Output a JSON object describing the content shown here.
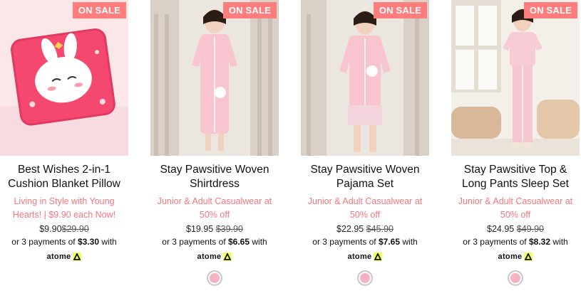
{
  "colors": {
    "sale_badge": "#ff7d7d",
    "promo_text": "#f2777f",
    "swatch_pink": "#f5b3c2",
    "atome_yellow": "#f0ff5a"
  },
  "products": [
    {
      "badge": "ON SALE",
      "title_line1": "Best Wishes 2-in-1",
      "title_line2": "Cushion Blanket Pillow",
      "promo_line1": "Living in Style with Young",
      "promo_line2": "Hearts! | $9.90 each Now!",
      "price": "$9.90",
      "old_price": "$29.90",
      "installment_prefix": "or 3 payments of",
      "installment_amount": "$3.30",
      "installment_suffix": "with",
      "pay_brand": "atome",
      "has_swatch": false
    },
    {
      "badge": "ON SALE",
      "title_line1": "Stay Pawsitive Woven",
      "title_line2": "Shirtdress",
      "promo_line1": "Junior & Adult Casualwear at",
      "promo_line2": "50% off",
      "price": "$19.95",
      "old_price": "$39.90",
      "installment_prefix": "or 3 payments of",
      "installment_amount": "$6.65",
      "installment_suffix": "with",
      "pay_brand": "atome",
      "has_swatch": true
    },
    {
      "badge": "ON SALE",
      "title_line1": "Stay Pawsitive Woven",
      "title_line2": "Pajama Set",
      "promo_line1": "Junior & Adult Casualwear at",
      "promo_line2": "50% off",
      "price": "$22.95",
      "old_price": "$45.90",
      "installment_prefix": "or 3 payments of",
      "installment_amount": "$7.65",
      "installment_suffix": "with",
      "pay_brand": "atome",
      "has_swatch": true
    },
    {
      "badge": "ON SALE",
      "title_line1": "Stay Pawsitive Top &",
      "title_line2": "Long Pants Sleep Set",
      "promo_line1": "Junior & Adult Casualwear at",
      "promo_line2": "50% off",
      "price": "$24.95",
      "old_price": "$49.90",
      "installment_prefix": "or 3 payments of",
      "installment_amount": "$8.32",
      "installment_suffix": "with",
      "pay_brand": "atome",
      "has_swatch": true
    }
  ]
}
